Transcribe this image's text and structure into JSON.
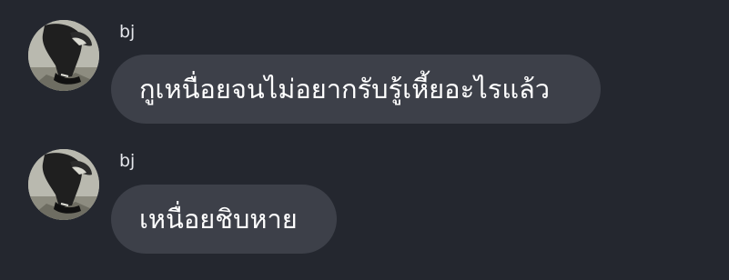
{
  "thread": {
    "messages": [
      {
        "sender": "bj",
        "avatar_icon": "user-photo-avatar",
        "text": "กูเหนื่อยจนไม่อยากรับรู้เหี้ยอะไรแล้ว"
      },
      {
        "sender": "bj",
        "avatar_icon": "user-photo-avatar",
        "text": "เหนื่อยชิบหาย"
      }
    ]
  },
  "colors": {
    "background": "#24272f",
    "bubble": "#3d4049",
    "text": "#ffffff",
    "sender_name": "#e4e6eb"
  }
}
